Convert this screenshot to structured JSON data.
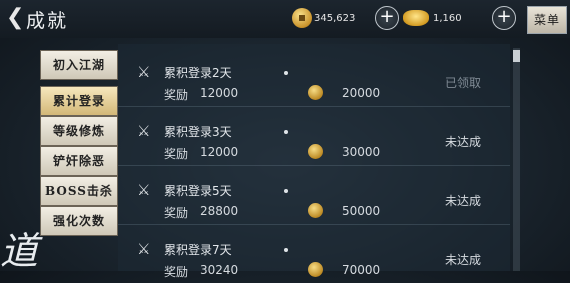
{
  "header": {
    "title": "成就",
    "coins": "345,623",
    "ingots": "1,160",
    "menu_label": "菜单"
  },
  "tabs": [
    {
      "label": "初入江湖",
      "active": false
    },
    {
      "label": "累计登录",
      "active": true
    },
    {
      "label": "等级修炼",
      "active": false
    },
    {
      "label": "铲奸除恶",
      "active": false
    },
    {
      "label": "BOSS击杀",
      "active": false
    },
    {
      "label": "强化次数",
      "active": false
    }
  ],
  "achievements": [
    {
      "title": "累积登录2天",
      "reward_label": "奖励",
      "exp": "12000",
      "coin": "20000",
      "status": "已领取"
    },
    {
      "title": "累积登录3天",
      "reward_label": "奖励",
      "exp": "12000",
      "coin": "30000",
      "status": "未达成"
    },
    {
      "title": "累积登录5天",
      "reward_label": "奖励",
      "exp": "28800",
      "coin": "50000",
      "status": "未达成"
    },
    {
      "title": "累积登录7天",
      "reward_label": "奖励",
      "exp": "30240",
      "coin": "70000",
      "status": "未达成"
    }
  ],
  "icons": {
    "back": "chevron-left-icon",
    "coin": "gold-coin-icon",
    "ingot": "gold-ingot-icon",
    "plus": "plus-icon",
    "row": "crossed-swords-icon"
  },
  "deco_text": "道"
}
